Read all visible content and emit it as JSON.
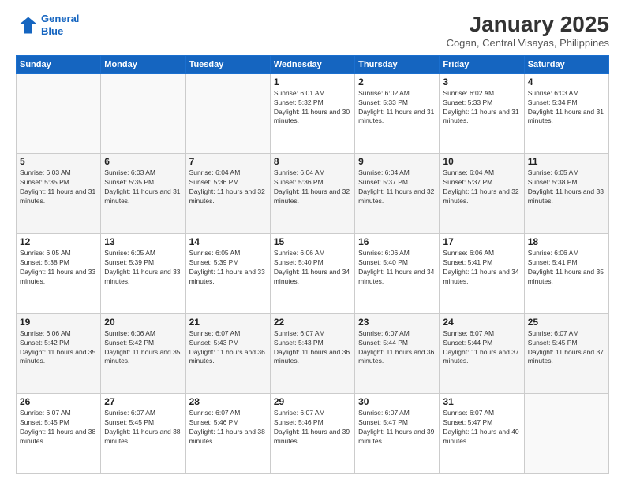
{
  "logo": {
    "line1": "General",
    "line2": "Blue"
  },
  "title": "January 2025",
  "subtitle": "Cogan, Central Visayas, Philippines",
  "days_of_week": [
    "Sunday",
    "Monday",
    "Tuesday",
    "Wednesday",
    "Thursday",
    "Friday",
    "Saturday"
  ],
  "weeks": [
    [
      {
        "day": "",
        "empty": true
      },
      {
        "day": "",
        "empty": true
      },
      {
        "day": "",
        "empty": true
      },
      {
        "day": "1",
        "sunrise": "6:01 AM",
        "sunset": "5:32 PM",
        "daylight": "11 hours and 30 minutes."
      },
      {
        "day": "2",
        "sunrise": "6:02 AM",
        "sunset": "5:33 PM",
        "daylight": "11 hours and 31 minutes."
      },
      {
        "day": "3",
        "sunrise": "6:02 AM",
        "sunset": "5:33 PM",
        "daylight": "11 hours and 31 minutes."
      },
      {
        "day": "4",
        "sunrise": "6:03 AM",
        "sunset": "5:34 PM",
        "daylight": "11 hours and 31 minutes."
      }
    ],
    [
      {
        "day": "5",
        "sunrise": "6:03 AM",
        "sunset": "5:35 PM",
        "daylight": "11 hours and 31 minutes."
      },
      {
        "day": "6",
        "sunrise": "6:03 AM",
        "sunset": "5:35 PM",
        "daylight": "11 hours and 31 minutes."
      },
      {
        "day": "7",
        "sunrise": "6:04 AM",
        "sunset": "5:36 PM",
        "daylight": "11 hours and 32 minutes."
      },
      {
        "day": "8",
        "sunrise": "6:04 AM",
        "sunset": "5:36 PM",
        "daylight": "11 hours and 32 minutes."
      },
      {
        "day": "9",
        "sunrise": "6:04 AM",
        "sunset": "5:37 PM",
        "daylight": "11 hours and 32 minutes."
      },
      {
        "day": "10",
        "sunrise": "6:04 AM",
        "sunset": "5:37 PM",
        "daylight": "11 hours and 32 minutes."
      },
      {
        "day": "11",
        "sunrise": "6:05 AM",
        "sunset": "5:38 PM",
        "daylight": "11 hours and 33 minutes."
      }
    ],
    [
      {
        "day": "12",
        "sunrise": "6:05 AM",
        "sunset": "5:38 PM",
        "daylight": "11 hours and 33 minutes."
      },
      {
        "day": "13",
        "sunrise": "6:05 AM",
        "sunset": "5:39 PM",
        "daylight": "11 hours and 33 minutes."
      },
      {
        "day": "14",
        "sunrise": "6:05 AM",
        "sunset": "5:39 PM",
        "daylight": "11 hours and 33 minutes."
      },
      {
        "day": "15",
        "sunrise": "6:06 AM",
        "sunset": "5:40 PM",
        "daylight": "11 hours and 34 minutes."
      },
      {
        "day": "16",
        "sunrise": "6:06 AM",
        "sunset": "5:40 PM",
        "daylight": "11 hours and 34 minutes."
      },
      {
        "day": "17",
        "sunrise": "6:06 AM",
        "sunset": "5:41 PM",
        "daylight": "11 hours and 34 minutes."
      },
      {
        "day": "18",
        "sunrise": "6:06 AM",
        "sunset": "5:41 PM",
        "daylight": "11 hours and 35 minutes."
      }
    ],
    [
      {
        "day": "19",
        "sunrise": "6:06 AM",
        "sunset": "5:42 PM",
        "daylight": "11 hours and 35 minutes."
      },
      {
        "day": "20",
        "sunrise": "6:06 AM",
        "sunset": "5:42 PM",
        "daylight": "11 hours and 35 minutes."
      },
      {
        "day": "21",
        "sunrise": "6:07 AM",
        "sunset": "5:43 PM",
        "daylight": "11 hours and 36 minutes."
      },
      {
        "day": "22",
        "sunrise": "6:07 AM",
        "sunset": "5:43 PM",
        "daylight": "11 hours and 36 minutes."
      },
      {
        "day": "23",
        "sunrise": "6:07 AM",
        "sunset": "5:44 PM",
        "daylight": "11 hours and 36 minutes."
      },
      {
        "day": "24",
        "sunrise": "6:07 AM",
        "sunset": "5:44 PM",
        "daylight": "11 hours and 37 minutes."
      },
      {
        "day": "25",
        "sunrise": "6:07 AM",
        "sunset": "5:45 PM",
        "daylight": "11 hours and 37 minutes."
      }
    ],
    [
      {
        "day": "26",
        "sunrise": "6:07 AM",
        "sunset": "5:45 PM",
        "daylight": "11 hours and 38 minutes."
      },
      {
        "day": "27",
        "sunrise": "6:07 AM",
        "sunset": "5:45 PM",
        "daylight": "11 hours and 38 minutes."
      },
      {
        "day": "28",
        "sunrise": "6:07 AM",
        "sunset": "5:46 PM",
        "daylight": "11 hours and 38 minutes."
      },
      {
        "day": "29",
        "sunrise": "6:07 AM",
        "sunset": "5:46 PM",
        "daylight": "11 hours and 39 minutes."
      },
      {
        "day": "30",
        "sunrise": "6:07 AM",
        "sunset": "5:47 PM",
        "daylight": "11 hours and 39 minutes."
      },
      {
        "day": "31",
        "sunrise": "6:07 AM",
        "sunset": "5:47 PM",
        "daylight": "11 hours and 40 minutes."
      },
      {
        "day": "",
        "empty": true
      }
    ]
  ]
}
